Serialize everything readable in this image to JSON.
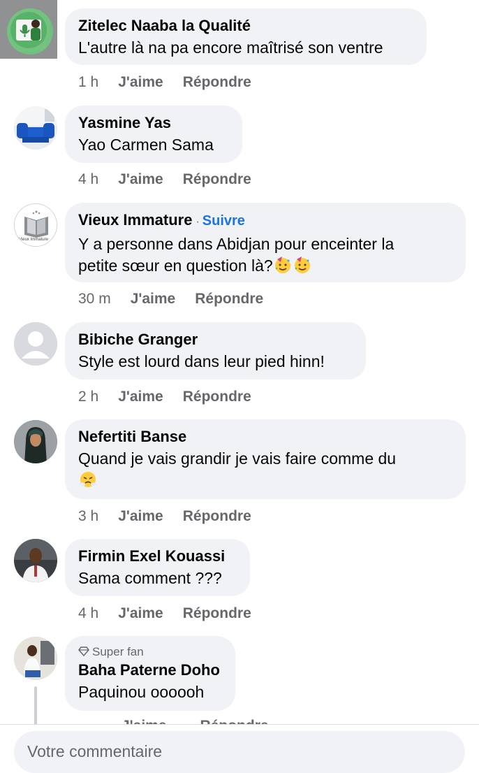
{
  "comments": [
    {
      "name": "Zitelec Naaba la Qualité",
      "text": "L'autre là na pa encore maîtrisé son ventre",
      "time": "1 h"
    },
    {
      "name": "Yasmine Yas",
      "text": "Yao Carmen Sama",
      "time": "4 h"
    },
    {
      "name": "Vieux Immature",
      "follow": "Suivre",
      "text_line1": "Y a personne dans Abidjan pour enceinter la",
      "text_line2": "petite sœur en question là?",
      "time": "30 m",
      "avatar_caption": "Vieux Immature"
    },
    {
      "name": "Bibiche Granger",
      "text": "Style est lourd dans leur pied hinn!",
      "time": "2 h"
    },
    {
      "name": "Nefertiti Banse",
      "text_line1": "Quand je vais grandir je vais faire comme du",
      "time": "3 h"
    },
    {
      "name": "Firmin Exel Kouassi",
      "text": "Sama comment ???",
      "time": "4 h"
    },
    {
      "badge": "Super fan",
      "name": "Baha Paterne Doho",
      "text": "Paquinou oooooh"
    }
  ],
  "actions": {
    "like": "J'aime",
    "reply": "Répondre"
  },
  "composer": {
    "placeholder": "Votre commentaire"
  },
  "colors": {
    "bubble": "#f0f2f5",
    "secondary_text": "#65676b",
    "follow_link": "#1b74e4"
  },
  "icons": [
    "microphone-icon",
    "default-avatar-icon",
    "diamond-icon",
    "party-face-emoji",
    "steam-nose-emoji"
  ]
}
